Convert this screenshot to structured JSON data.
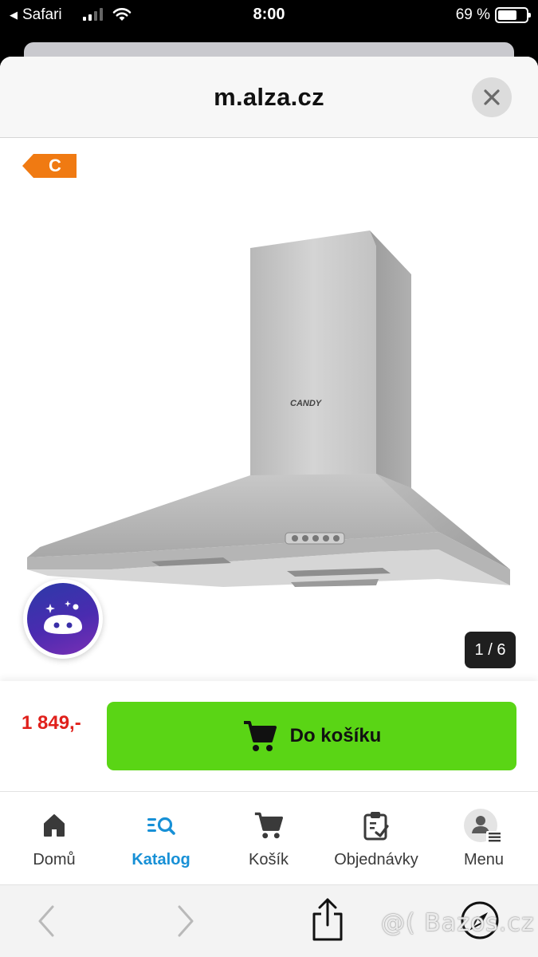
{
  "status_bar": {
    "back_app": "Safari",
    "time": "8:00",
    "battery_text": "69 %",
    "battery_level": 0.69
  },
  "header": {
    "domain": "m.alza.cz",
    "close_icon": "close-icon"
  },
  "product": {
    "energy_class": "C",
    "energy_color": "#f07a12",
    "brand_on_image": "CANDY",
    "image_counter": "1 / 6"
  },
  "buy": {
    "price": "1 849,-",
    "cart_label": "Do košíku",
    "price_color": "#e0201b",
    "button_color": "#5ad515"
  },
  "nav": {
    "items": [
      {
        "label": "Domů",
        "icon": "home-icon"
      },
      {
        "label": "Katalog",
        "icon": "catalog-search-icon",
        "active": true
      },
      {
        "label": "Košík",
        "icon": "cart-icon"
      },
      {
        "label": "Objednávky",
        "icon": "orders-clipboard-icon"
      },
      {
        "label": "Menu",
        "icon": "user-menu-icon"
      }
    ],
    "active_color": "#1790d6"
  },
  "safari_toolbar": {
    "watermark": "@( Bazos.cz"
  }
}
